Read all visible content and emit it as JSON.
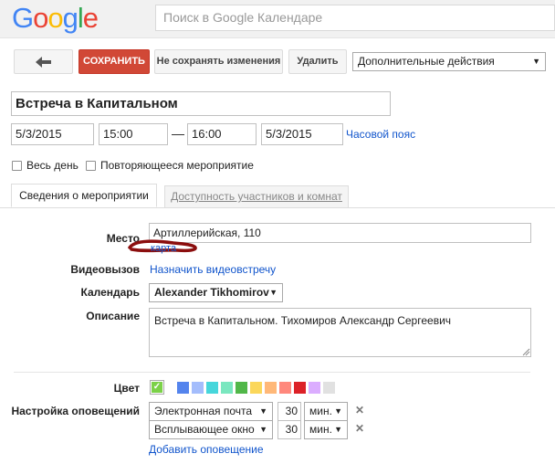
{
  "header": {
    "logo": "Google",
    "search_placeholder": "Поиск в Google Календаре"
  },
  "toolbar": {
    "back_icon": "back-arrow-icon",
    "save_label": "СОХРАНИТЬ",
    "discard_label": "Не сохранять изменения",
    "delete_label": "Удалить",
    "more_actions": "Дополнительные действия"
  },
  "event": {
    "title": "Встреча в Капитальном",
    "start_date": "5/3/2015",
    "start_time": "15:00",
    "dash": "—",
    "end_time": "16:00",
    "end_date": "5/3/2015",
    "timezone_link": "Часовой пояс",
    "all_day_label": "Весь день",
    "recurring_label": "Повторяющееся мероприятие"
  },
  "tabs": [
    {
      "label": "Сведения о мероприятии",
      "active": true
    },
    {
      "label": "Доступность участников и комнат",
      "active": false
    }
  ],
  "details": {
    "where_label": "Место",
    "where_value": "Артиллерийская, 110",
    "map_link": "карта",
    "video_label": "Видеовызов",
    "video_link": "Назначить видеовстречу",
    "calendar_label": "Календарь",
    "calendar_value": "Alexander Tikhomirov",
    "description_label": "Описание",
    "description_value": "Встреча в Капитальном. Тихомиров Александр Сергеевич"
  },
  "color": {
    "label": "Цвет",
    "check_icon": "checkmark-icon",
    "swatches": [
      "#7bd148",
      "#5484ed",
      "#a4bdfc",
      "#46d6db",
      "#7ae7bf",
      "#51b749",
      "#fbd75b",
      "#ffb878",
      "#ff887c",
      "#dc2127",
      "#dbadff",
      "#e1e1e1"
    ]
  },
  "notifications": {
    "label": "Настройка оповещений",
    "rows": [
      {
        "method": "Электронная почта",
        "value": "30",
        "unit": "мин."
      },
      {
        "method": "Всплывающее окно",
        "value": "30",
        "unit": "мин."
      }
    ],
    "add_link": "Добавить оповещение"
  }
}
